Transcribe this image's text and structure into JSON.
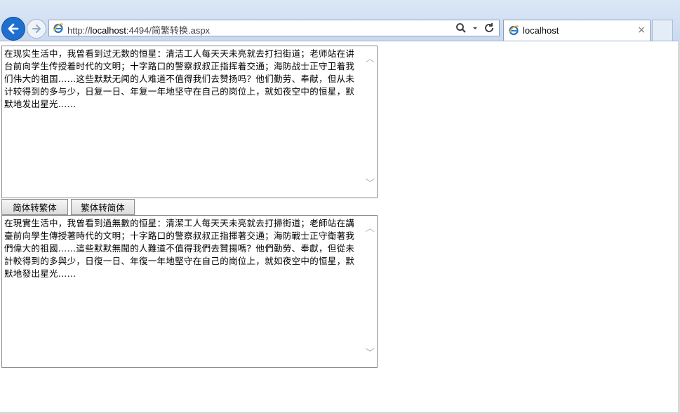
{
  "browser": {
    "url_prefix": "http://",
    "url_host": "localhost",
    "url_rest": ":4494/简繁转换.aspx",
    "tab_title": "localhost",
    "tab_close": "×"
  },
  "textareas": {
    "simplified": "在现实生活中，我曾看到过无数的恒星：清洁工人每天天未亮就去打扫街道；老师站在讲台前向学生传授着时代的文明；十字路口的警察叔叔正指挥着交通；海防战士正守卫着我们伟大的祖国……这些默默无闻的人难道不值得我们去赞扬吗？他们勤劳、奉献，但从未计较得到的多与少，日复一日、年复一年地坚守在自己的岗位上，就如夜空中的恒星，默默地发出星光……",
    "traditional": "在現實生活中，我曾看到過無數的恒星：清潔工人每天天未亮就去打掃街道；老師站在講臺前向學生傳授著時代的文明；十字路口的警察叔叔正指揮著交通；海防戰士正守衛著我們偉大的祖國……這些默默無聞的人難道不值得我們去贊揚嗎？他們勤勞、奉獻，但從未計較得到的多與少，日復一日、年復一年地堅守在自己的崗位上，就如夜空中的恒星，默默地發出星光……"
  },
  "buttons": {
    "to_traditional": "简体转繁体",
    "to_simplified": "繁体转简体"
  }
}
